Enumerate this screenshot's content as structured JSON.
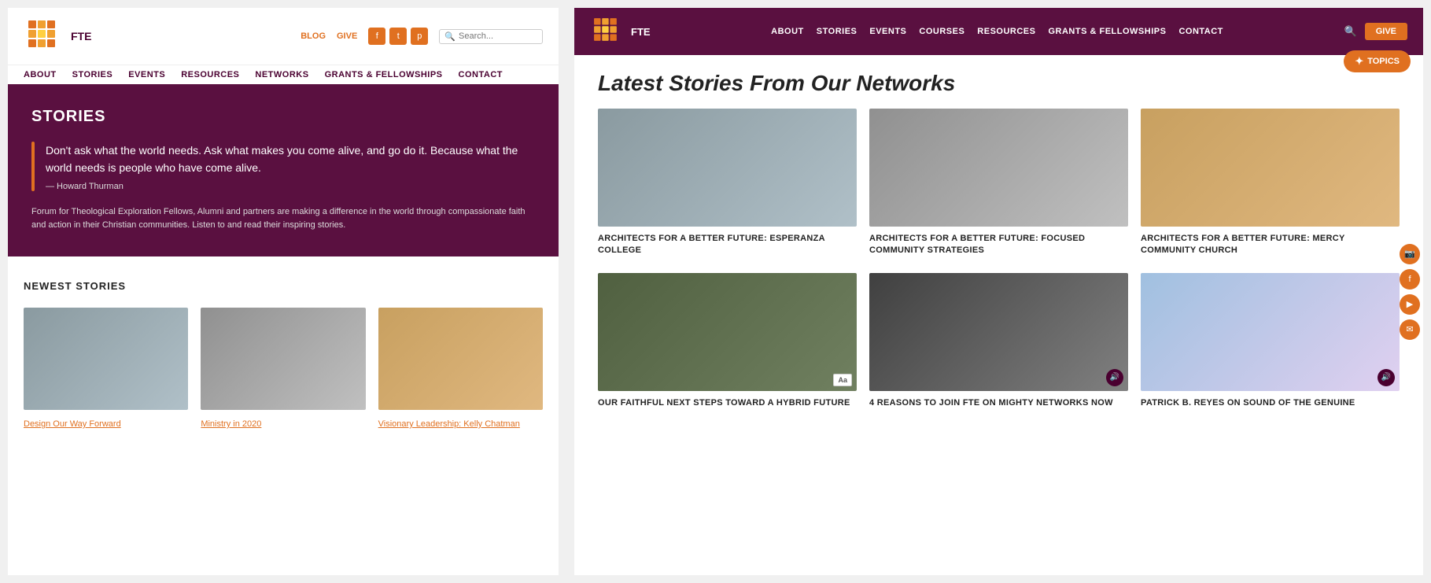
{
  "left": {
    "logo_text": "FTE",
    "header_links": [
      "BLOG",
      "GIVE"
    ],
    "social": [
      "f",
      "t",
      "p"
    ],
    "nav": [
      "ABOUT",
      "STORIES",
      "EVENTS",
      "RESOURCES",
      "NETWORKS",
      "GRANTS & FELLOWSHIPS",
      "CONTACT"
    ],
    "hero": {
      "title": "STORIES",
      "quote": "Don't ask what the world needs. Ask what makes you come alive, and go do it. Because what the world needs is people who have come alive.",
      "author": "— Howard Thurman",
      "description": "Forum for Theological Exploration Fellows, Alumni and partners are making a difference in the world through compassionate faith and action in their Christian communities. Listen to and read their inspiring stories."
    },
    "newest": {
      "title": "NEWEST STORIES",
      "stories": [
        {
          "link": "Design Our Way Forward"
        },
        {
          "link": "Ministry in 2020"
        },
        {
          "link": "Visionary Leadership: Kelly Chatman"
        }
      ]
    }
  },
  "right": {
    "logo_text": "FTE",
    "nav": [
      "ABOUT",
      "STORIES",
      "EVENTS",
      "COURSES",
      "RESOURCES",
      "GRANTS & FELLOWSHIPS",
      "CONTACT"
    ],
    "give_label": "GIVE",
    "section_title": "Latest Stories From Our Networks",
    "topics_label": "TOPICS",
    "cards_row1": [
      {
        "title": "ARCHITECTS FOR A BETTER FUTURE: ESPERANZA COLLEGE"
      },
      {
        "title": "ARCHITECTS FOR A BETTER FUTURE: FOCUSED COMMUNITY STRATEGIES"
      },
      {
        "title": "ARCHITECTS FOR A BETTER FUTURE: MERCY COMMUNITY CHURCH"
      }
    ],
    "cards_row2": [
      {
        "title": "OUR FAITHFUL NEXT STEPS TOWARD A HYBRID FUTURE",
        "badge": "Aa"
      },
      {
        "title": "4 REASONS TO JOIN FTE ON MIGHTY NETWORKS NOW",
        "badge": "audio"
      },
      {
        "title": "PATRICK B. REYES ON SOUND OF THE GENUINE",
        "badge": "audio"
      }
    ],
    "social_icons": [
      "instagram",
      "facebook",
      "youtube",
      "mail"
    ]
  }
}
